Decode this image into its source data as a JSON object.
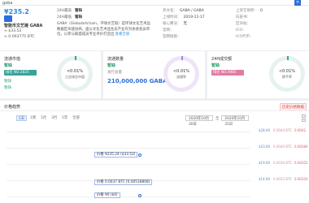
{
  "topbar": {
    "title": "gaba",
    "close": "×"
  },
  "header": {
    "price": "¥235.2",
    "coin_name": "智能币文艺链 GABA",
    "price_usd": "≈ $33.52",
    "price_btc": "≈ 0.003775 BTC",
    "high_label": "24H最高",
    "high_value": "暂缺",
    "low_label": "24H最低",
    "low_value": "暂缺",
    "description": "GABA（Globalartchain，环球文艺链）是环球文化艺术品数据区块链协商，面以文化艺术品生态产业作为协会会员单位，以参与联盟成员专业评价打造出",
    "more": "查看全部",
    "info_col1": [
      {
        "k": "英文名：",
        "v": "GABA / GABA"
      },
      {
        "k": "上线时间：",
        "v": "2019-11-17"
      },
      {
        "k": "核心算法：",
        "v": "无"
      },
      {
        "k": "官网：",
        "v": ""
      },
      {
        "k": "官网链接：",
        "v": ""
      }
    ],
    "info_col2": [
      {
        "k": "上架交易所：",
        "v": "0"
      },
      {
        "k": "白皮书：",
        "v": ""
      },
      {
        "k": "区块站：",
        "v": ""
      },
      {
        "k": "ICO：",
        "v": ""
      },
      {
        "k": "ICO代币：",
        "v": ""
      }
    ]
  },
  "cards": [
    {
      "title": "流通市值",
      "value": "暂缺",
      "badge": "排名 NO.2825",
      "small1": "暂缺",
      "small2": "暂缺",
      "ring_pct": "<0.01%",
      "ring_label": "占全球总市值"
    },
    {
      "title": "流通数量",
      "value": "暂缺",
      "label2": "发行总量",
      "big": "210,000,000 GABA",
      "ring_pct": "<0.01%",
      "ring_label": "流通率"
    },
    {
      "title": "24H成交额",
      "value": "暂缺",
      "badge": "排名 NO.4985",
      "ring_pct": "<0.01%",
      "ring_label": "换手率"
    }
  ],
  "chart": {
    "title": "价格趋势",
    "link": "历史价格数据",
    "ranges": [
      "1天",
      "1周",
      "1月",
      "3月",
      "1年",
      "全部"
    ],
    "active_range": "1天",
    "date_from": "2020年10月30日",
    "date_to": "2020年10月31日",
    "date_sep": "至",
    "tips": [
      "价格 ¥235.24 ($33.52)",
      "价格 0.0037 BTC [0.00518808]",
      "价格 ¥0 ($0)"
    ],
    "y_right": [
      "$28.40",
      "$23.00",
      "$19.00",
      "$14.00"
    ],
    "y_right2": [
      "0.0044 BTC",
      "0.0040 BTC",
      "0.0036 BTC",
      "0.0032 BTC"
    ],
    "y_far": [
      "0.0042",
      "0.00384",
      "0.00352",
      "0.00320"
    ]
  },
  "colors": {
    "accent": "#2b6fd9",
    "green": "#2e9e6f",
    "teal": "#3aa29a",
    "pink": "#e07ba1"
  }
}
